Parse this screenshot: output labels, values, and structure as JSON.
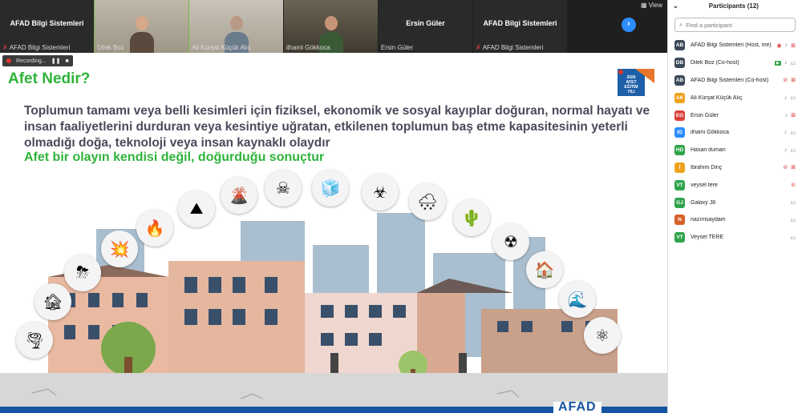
{
  "top_strip": {
    "view_label": "View",
    "tiles": [
      {
        "big": "AFAD Bilgi Sistemleri",
        "caption": "AFAD Bilgi Sistemleri",
        "muted": true
      },
      {
        "caption": "Dilek Boz",
        "muted": false
      },
      {
        "caption": "Ali Kürşat Küçük Alıç",
        "muted": false
      },
      {
        "caption": "ilhami Gökkoca",
        "muted": false
      },
      {
        "big": "Ersin Güler",
        "caption": "Ersin Güler",
        "muted": false
      },
      {
        "big": "AFAD Bilgi Sistemleri",
        "caption": "AFAD Bilgi Sistemleri",
        "muted": true
      }
    ]
  },
  "recording": {
    "label": "Recording..."
  },
  "slide": {
    "title": "Afet Nedir?",
    "body": "Toplumun tamamı veya belli kesimleri için fiziksel, ekonomik ve sosyal kayıplar doğuran, normal hayatı ve insan faaliyetlerini durduran veya kesintiye uğratan, etkilenen toplumun baş etme kapasitesinin yeterli olmadığı doğa, teknoloji veya insan kaynaklı olaydır",
    "highlight": "Afet bir olayın kendisi değil, doğurduğu sonuçtur",
    "footer_mark": "AFAD",
    "logo_lines": [
      "2020",
      "AFET",
      "EĞİTİM",
      "YILI"
    ]
  },
  "participants": {
    "title": "Participants (12)",
    "search_placeholder": "Find a participant",
    "list": [
      {
        "initials": "AB",
        "color": "#3c4a5a",
        "name": "AFAD Bilgi Sistemleri (Host, me)",
        "mic": "on",
        "cam": "off",
        "extra": "eye"
      },
      {
        "initials": "DB",
        "color": "#3c4a5a",
        "name": "Dilek Boz (Co-host)",
        "mic": "on",
        "cam": "on",
        "extra": "share"
      },
      {
        "initials": "AB",
        "color": "#3c4a5a",
        "name": "AFAD Bilgi Sistemleri (Co-host)",
        "mic": "off",
        "cam": "off",
        "extra": "none"
      },
      {
        "initials": "AK",
        "color": "#f0a21a",
        "name": "Ali Kürşat Küçük Alıç",
        "mic": "on",
        "cam": "on",
        "extra": "none"
      },
      {
        "initials": "EG",
        "color": "#d9403a",
        "name": "Ersin Güler",
        "mic": "on",
        "cam": "off",
        "extra": "none"
      },
      {
        "initials": "IG",
        "color": "#2d8cff",
        "name": "ilhami Gökkoca",
        "mic": "on",
        "cam": "on",
        "extra": "none"
      },
      {
        "initials": "HD",
        "color": "#2fa34a",
        "name": "Hasan duman",
        "mic": "on",
        "cam": "on",
        "extra": "none"
      },
      {
        "initials": "İ",
        "color": "#f0a21a",
        "name": "İbrahim Dinç",
        "mic": "off",
        "cam": "off",
        "extra": "none"
      },
      {
        "initials": "VT",
        "color": "#2fa34a",
        "name": "veysel tere",
        "mic": "off",
        "cam": "none",
        "extra": "none"
      },
      {
        "initials": "GJ",
        "color": "#2fa34a",
        "name": "Galaxy J8",
        "mic": "none",
        "cam": "on",
        "extra": "none"
      },
      {
        "initials": "N",
        "color": "#d9602a",
        "name": "nazımsaydam",
        "mic": "none",
        "cam": "on",
        "extra": "none"
      },
      {
        "initials": "VT",
        "color": "#2fa34a",
        "name": "Veysel TERE",
        "mic": "none",
        "cam": "on",
        "extra": "none"
      }
    ]
  }
}
